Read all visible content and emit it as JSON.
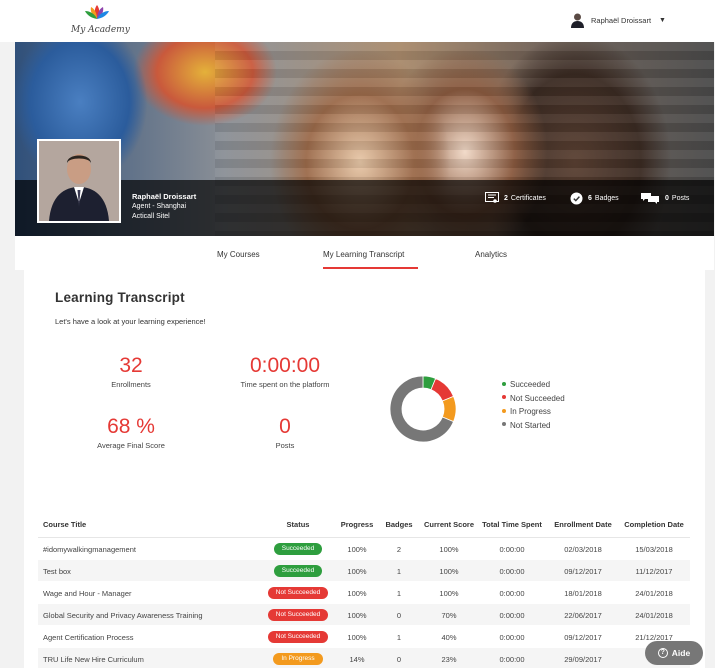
{
  "header": {
    "app_name": "My Academy",
    "user_name": "Raphaël Droissart"
  },
  "profile": {
    "name": "Raphaël Droissart",
    "role": "Agent - Shanghai",
    "company": "Acticall Sitel",
    "stats": {
      "certificates_count": "2",
      "certificates_label": "Certificates",
      "badges_count": "6",
      "badges_label": "Badges",
      "posts_count": "0",
      "posts_label": "Posts"
    }
  },
  "tabs": [
    {
      "label": "My Courses",
      "active": false
    },
    {
      "label": "My Learning Transcript",
      "active": true
    },
    {
      "label": "Analytics",
      "active": false
    }
  ],
  "transcript": {
    "title": "Learning Transcript",
    "subtitle": "Let's have a look at your learning experience!",
    "stats": {
      "enrollments_value": "32",
      "enrollments_label": "Enrollments",
      "time_value": "0:00:00",
      "time_label": "Time spent on the platform",
      "score_value": "68 %",
      "score_label": "Average Final Score",
      "posts_value": "0",
      "posts_label": "Posts"
    },
    "legend": [
      {
        "label": "Succeeded",
        "color": "#2e9e3e"
      },
      {
        "label": "Not Succeeded",
        "color": "#e53935"
      },
      {
        "label": "In Progress",
        "color": "#f39a1e"
      },
      {
        "label": "Not Started",
        "color": "#777777"
      }
    ],
    "chart_data": {
      "type": "pie",
      "categories": [
        "Succeeded",
        "Not Succeeded",
        "In Progress",
        "Not Started"
      ],
      "values": [
        2,
        4,
        4,
        22
      ],
      "colors": [
        "#2e9e3e",
        "#e53935",
        "#f39a1e",
        "#777777"
      ],
      "donut": true
    },
    "table": {
      "headers": {
        "course_title": "Course Title",
        "status": "Status",
        "progress": "Progress",
        "badges": "Badges",
        "current_score": "Current Score",
        "total_time": "Total Time Spent",
        "enrollment_date": "Enrollment Date",
        "completion_date": "Completion Date"
      },
      "rows": [
        {
          "title": "#idomywalkingmanagement",
          "status": "Succeeded",
          "status_color": "#2e9e3e",
          "progress": "100%",
          "badges": "2",
          "score": "100%",
          "time": "0:00:00",
          "enrollment": "02/03/2018",
          "completion": "15/03/2018"
        },
        {
          "title": "Test box",
          "status": "Succeeded",
          "status_color": "#2e9e3e",
          "progress": "100%",
          "badges": "1",
          "score": "100%",
          "time": "0:00:00",
          "enrollment": "09/12/2017",
          "completion": "11/12/2017"
        },
        {
          "title": "Wage and Hour - Manager",
          "status": "Not Succeeded",
          "status_color": "#e53935",
          "progress": "100%",
          "badges": "1",
          "score": "100%",
          "time": "0:00:00",
          "enrollment": "18/01/2018",
          "completion": "24/01/2018"
        },
        {
          "title": "Global Security and Privacy Awareness Training",
          "status": "Not Succeeded",
          "status_color": "#e53935",
          "progress": "100%",
          "badges": "0",
          "score": "70%",
          "time": "0:00:00",
          "enrollment": "22/06/2017",
          "completion": "24/01/2018"
        },
        {
          "title": "Agent Certification Process",
          "status": "Not Succeeded",
          "status_color": "#e53935",
          "progress": "100%",
          "badges": "1",
          "score": "40%",
          "time": "0:00:00",
          "enrollment": "09/12/2017",
          "completion": "21/12/2017"
        },
        {
          "title": "TRU Life New Hire Curriculum",
          "status": "In Progress",
          "status_color": "#f39a1e",
          "progress": "14%",
          "badges": "0",
          "score": "23%",
          "time": "0:00:00",
          "enrollment": "29/09/2017",
          "completion": ""
        }
      ]
    }
  },
  "help": {
    "label": "Aide"
  }
}
